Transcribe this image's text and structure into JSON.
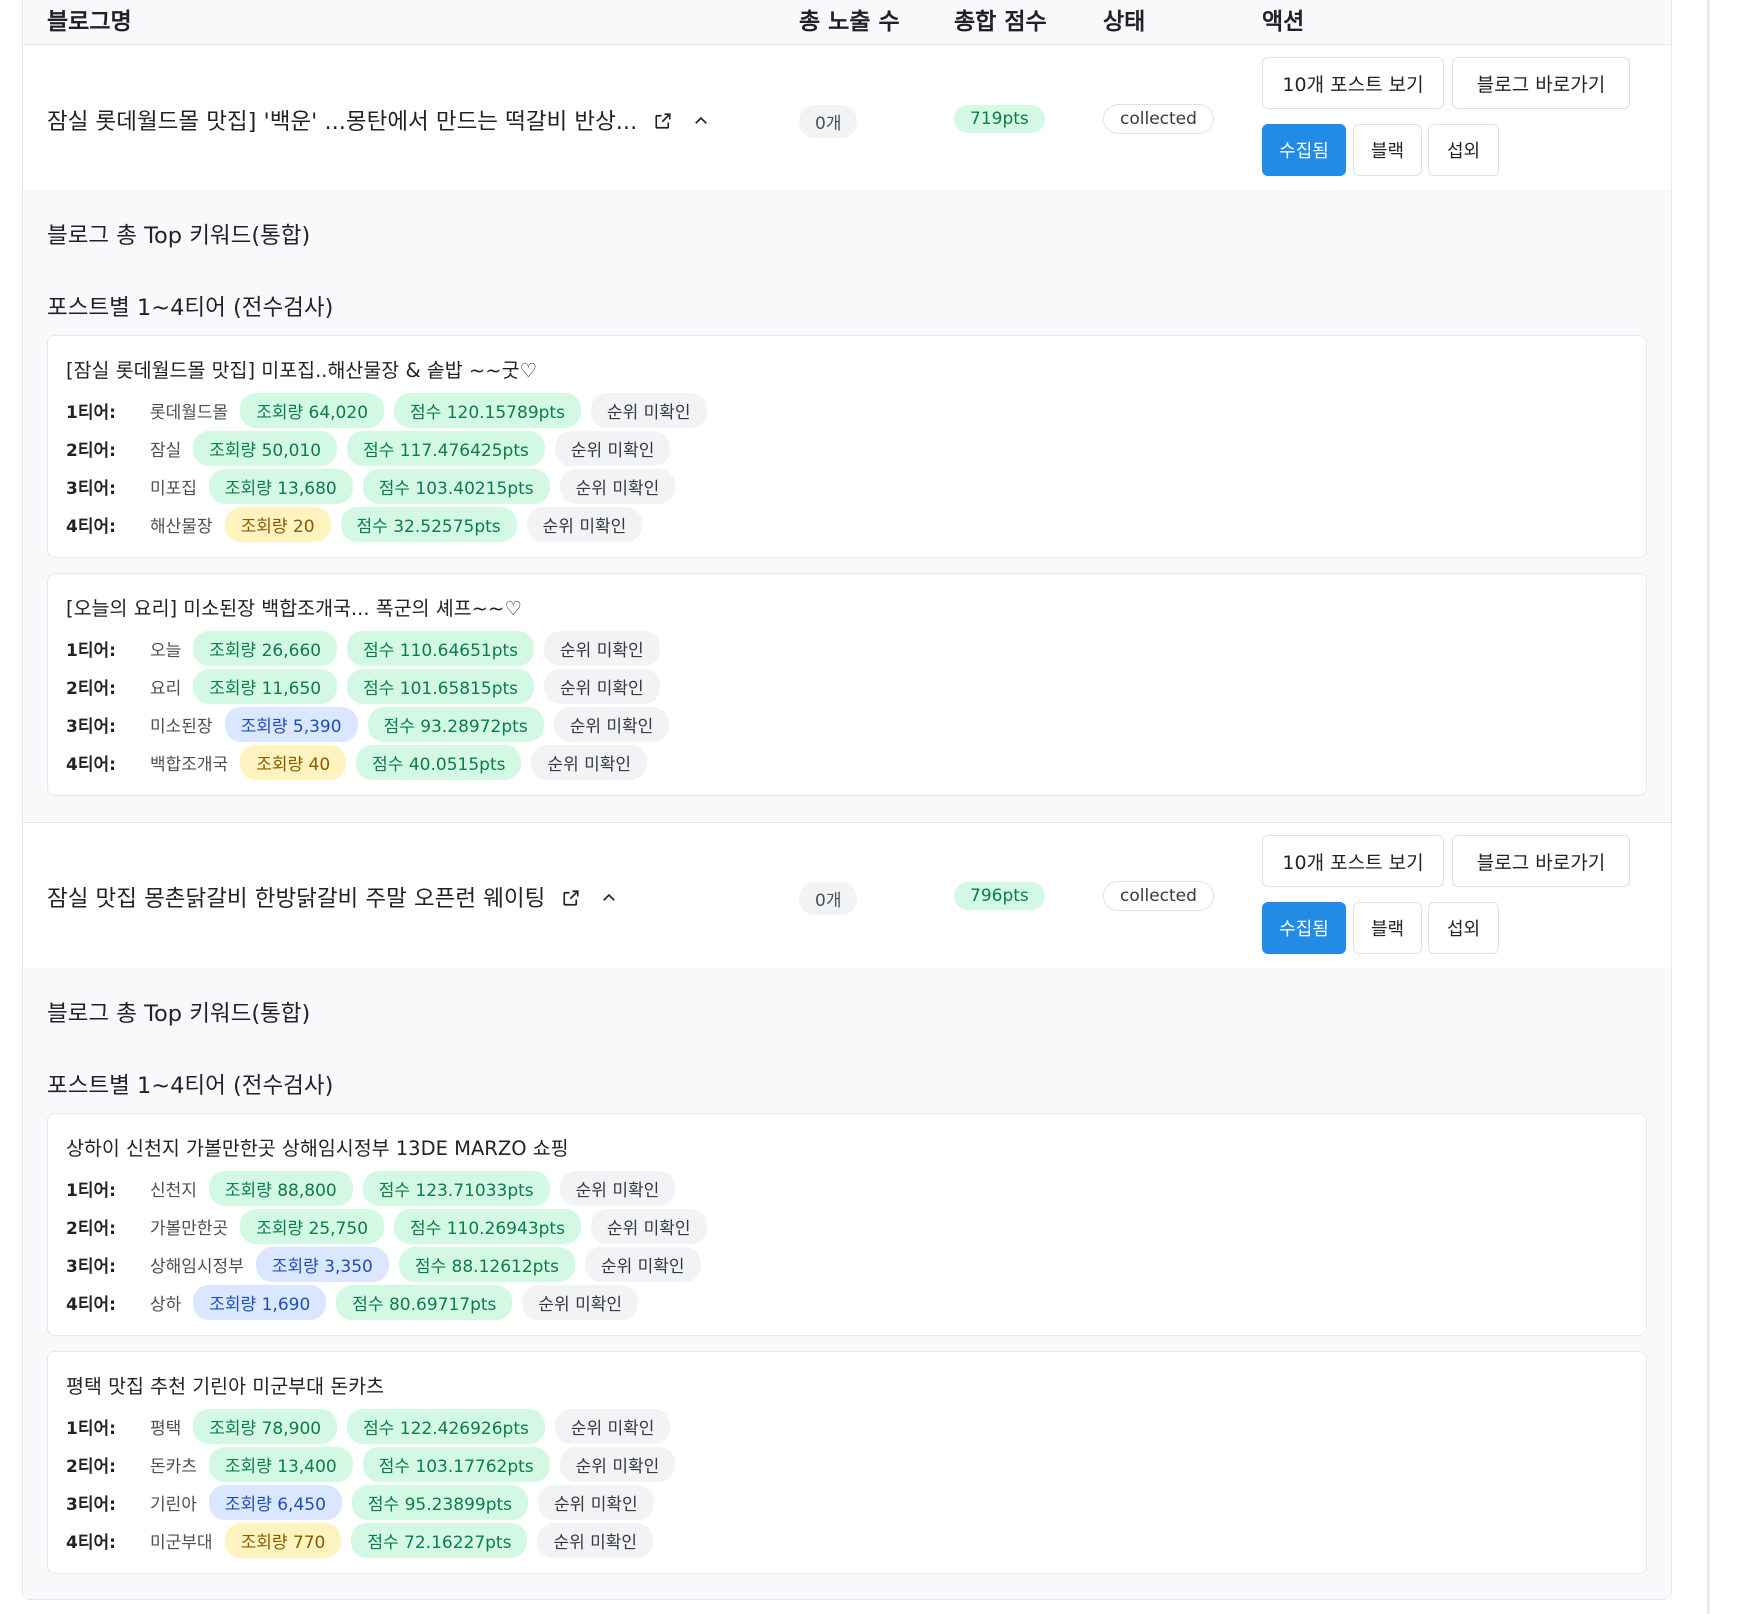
{
  "header": {
    "col_blog": "블로그명",
    "col_exposure": "총 노출 수",
    "col_score": "총합 점수",
    "col_status": "상태",
    "col_action": "액션"
  },
  "blogs": [
    {
      "title": "잠실 롯데월드몰 맛집] '백운' ...몽탄에서 만드는 떡갈비 반상...",
      "exposure": "0개",
      "score": "719pts",
      "status": "collected",
      "actions": {
        "view_posts": "10개 포스트 보기",
        "go_blog": "블로그 바로가기",
        "collected": "수집됨",
        "black": "블랙",
        "contact": "섭외"
      },
      "top_keywords_label": "블로그 총 Top 키워드(통합)",
      "tier_section_label": "포스트별 1~4티어 (전수검사)",
      "posts": [
        {
          "title": "[잠실 롯데월드몰 맛집] 미포집..해산물장 & 솥밥 ~~굿♡",
          "tiers": [
            {
              "label": "1티어:",
              "keyword": "롯데월드몰",
              "views": "조회량 64,020",
              "views_level": "green",
              "score": "점수 120.15789pts",
              "rank": "순위 미확인"
            },
            {
              "label": "2티어:",
              "keyword": "잠실",
              "views": "조회량 50,010",
              "views_level": "green",
              "score": "점수 117.476425pts",
              "rank": "순위 미확인"
            },
            {
              "label": "3티어:",
              "keyword": "미포집",
              "views": "조회량 13,680",
              "views_level": "green",
              "score": "점수 103.40215pts",
              "rank": "순위 미확인"
            },
            {
              "label": "4티어:",
              "keyword": "해산물장",
              "views": "조회량 20",
              "views_level": "yellow",
              "score": "점수 32.52575pts",
              "rank": "순위 미확인"
            }
          ]
        },
        {
          "title": "[오늘의 요리] 미소된장 백합조개국... 폭군의 셰프~~♡",
          "tiers": [
            {
              "label": "1티어:",
              "keyword": "오늘",
              "views": "조회량 26,660",
              "views_level": "green",
              "score": "점수 110.64651pts",
              "rank": "순위 미확인"
            },
            {
              "label": "2티어:",
              "keyword": "요리",
              "views": "조회량 11,650",
              "views_level": "green",
              "score": "점수 101.65815pts",
              "rank": "순위 미확인"
            },
            {
              "label": "3티어:",
              "keyword": "미소된장",
              "views": "조회량 5,390",
              "views_level": "blue",
              "score": "점수 93.28972pts",
              "rank": "순위 미확인"
            },
            {
              "label": "4티어:",
              "keyword": "백합조개국",
              "views": "조회량 40",
              "views_level": "yellow",
              "score": "점수 40.0515pts",
              "rank": "순위 미확인"
            }
          ]
        }
      ]
    },
    {
      "title": "잠실 맛집 몽촌닭갈비 한방닭갈비 주말 오픈런 웨이팅",
      "exposure": "0개",
      "score": "796pts",
      "status": "collected",
      "actions": {
        "view_posts": "10개 포스트 보기",
        "go_blog": "블로그 바로가기",
        "collected": "수집됨",
        "black": "블랙",
        "contact": "섭외"
      },
      "top_keywords_label": "블로그 총 Top 키워드(통합)",
      "tier_section_label": "포스트별 1~4티어 (전수검사)",
      "posts": [
        {
          "title": "상하이 신천지 가볼만한곳 상해임시정부 13DE MARZO 쇼핑",
          "tiers": [
            {
              "label": "1티어:",
              "keyword": "신천지",
              "views": "조회량 88,800",
              "views_level": "green",
              "score": "점수 123.71033pts",
              "rank": "순위 미확인"
            },
            {
              "label": "2티어:",
              "keyword": "가볼만한곳",
              "views": "조회량 25,750",
              "views_level": "green",
              "score": "점수 110.26943pts",
              "rank": "순위 미확인"
            },
            {
              "label": "3티어:",
              "keyword": "상해임시정부",
              "views": "조회량 3,350",
              "views_level": "blue",
              "score": "점수 88.12612pts",
              "rank": "순위 미확인"
            },
            {
              "label": "4티어:",
              "keyword": "상하",
              "views": "조회량 1,690",
              "views_level": "blue",
              "score": "점수 80.69717pts",
              "rank": "순위 미확인"
            }
          ]
        },
        {
          "title": "평택 맛집 추천 기린아 미군부대 돈카츠",
          "tiers": [
            {
              "label": "1티어:",
              "keyword": "평택",
              "views": "조회량 78,900",
              "views_level": "green",
              "score": "점수 122.426926pts",
              "rank": "순위 미확인"
            },
            {
              "label": "2티어:",
              "keyword": "돈카츠",
              "views": "조회량 13,400",
              "views_level": "green",
              "score": "점수 103.17762pts",
              "rank": "순위 미확인"
            },
            {
              "label": "3티어:",
              "keyword": "기린아",
              "views": "조회량 6,450",
              "views_level": "blue",
              "score": "점수 95.23899pts",
              "rank": "순위 미확인"
            },
            {
              "label": "4티어:",
              "keyword": "미군부대",
              "views": "조회량 770",
              "views_level": "yellow",
              "score": "점수 72.16227pts",
              "rank": "순위 미확인"
            }
          ]
        }
      ]
    }
  ],
  "colors": {
    "primary": "#228be6",
    "chip_green_bg": "#d3f9e4",
    "chip_yellow_bg": "#fff3bf",
    "chip_blue_bg": "#dbe7ff",
    "chip_gray_bg": "#f1f3f5"
  }
}
